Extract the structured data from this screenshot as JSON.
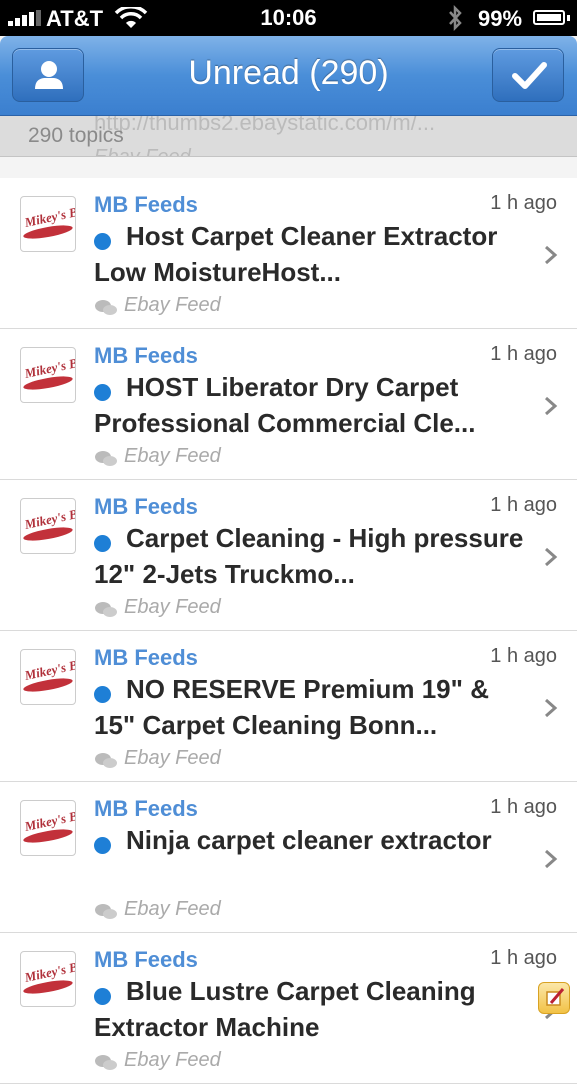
{
  "status_bar": {
    "carrier": "AT&T",
    "time": "10:06",
    "battery": "99%",
    "battery_level": 0.99
  },
  "nav": {
    "title": "Unread (290)",
    "left_icon": "person-icon",
    "right_icon": "checkmark-icon",
    "accent": "#4a8ed8"
  },
  "pull": {
    "url": "http://thumbs2.ebaystatic.com/m/...",
    "topics": "290 topics",
    "feed": "Ebay Feed"
  },
  "items": [
    {
      "feed": "MB Feeds",
      "time": "1 h ago",
      "title": "Host Carpet Cleaner Extractor Low MoistureHost...",
      "sub": "Ebay Feed"
    },
    {
      "feed": "MB Feeds",
      "time": "1 h ago",
      "title": "HOST Liberator Dry Carpet Professional Commercial Cle...",
      "sub": "Ebay Feed"
    },
    {
      "feed": "MB Feeds",
      "time": "1 h ago",
      "title": "Carpet Cleaning - High pressure 12\" 2-Jets Truckmo...",
      "sub": "Ebay Feed"
    },
    {
      "feed": "MB Feeds",
      "time": "1 h ago",
      "title": "NO RESERVE Premium 19\" & 15\"  Carpet Cleaning Bonn...",
      "sub": "Ebay Feed"
    },
    {
      "feed": "MB Feeds",
      "time": "1 h ago",
      "title": "Ninja carpet cleaner extractor",
      "sub": "Ebay Feed"
    },
    {
      "feed": "MB Feeds",
      "time": "1 h ago",
      "title": "Blue Lustre Carpet Cleaning Extractor Machine",
      "sub": "Ebay Feed"
    }
  ],
  "avatar_text": "Mikey's Board",
  "unread_dot_color": "#1e7fd6"
}
